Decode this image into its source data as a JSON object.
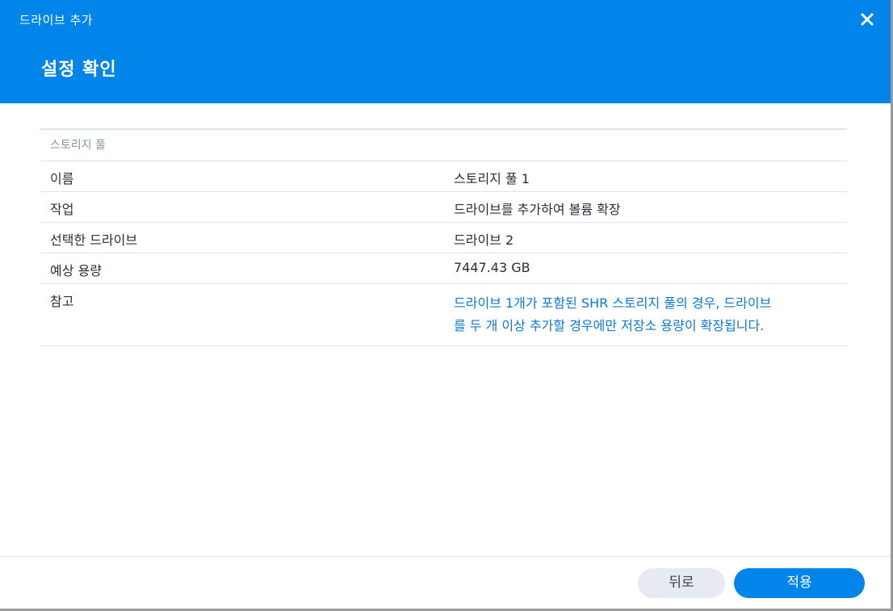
{
  "window": {
    "title": "드라이브 추가",
    "close_icon": "close-icon"
  },
  "step": {
    "title": "설정 확인"
  },
  "summary": {
    "group_title": "스토리지 풀",
    "rows": [
      {
        "label": "이름",
        "value": "스토리지 풀 1"
      },
      {
        "label": "작업",
        "value": "드라이브를 추가하여 볼륨 확장"
      },
      {
        "label": "선택한 드라이브",
        "value": "드라이브 2"
      },
      {
        "label": "예상 용량",
        "value": "7447.43 GB"
      }
    ],
    "note": {
      "label": "참고",
      "line1": "드라이브 1개가 포함된 SHR 스토리지 풀의 경우, 드라이브",
      "line2": "를 두 개 이상 추가할 경우에만 저장소 용량이 확장됩니다."
    }
  },
  "footer": {
    "back_label": "뒤로",
    "apply_label": "적용"
  },
  "colors": {
    "accent": "#0285ea",
    "note_text": "#0b79d6",
    "secondary_button": "#e6ebf1"
  }
}
